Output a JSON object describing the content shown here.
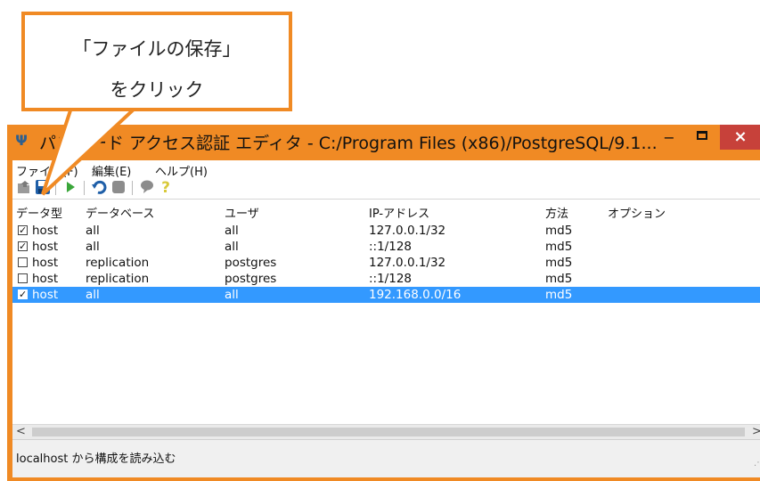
{
  "window": {
    "title": "パスワード アクセス認証 エディタ - C:/Program Files (x86)/PostgreSQL/9.1...",
    "minimize": "−",
    "close": "×"
  },
  "menu": {
    "file": "ファイル(F)",
    "edit": "編集(E)",
    "help": "ヘルプ(H)"
  },
  "toolbar": {
    "icons": [
      "open-file-icon",
      "save-file-icon",
      "run-icon",
      "undo-icon",
      "stop-icon",
      "comment-icon",
      "help-icon"
    ]
  },
  "table": {
    "headers": [
      "データ型",
      "データベース",
      "ユーザ",
      "IP-アドレス",
      "方法",
      "オプション"
    ],
    "rows": [
      {
        "checked": true,
        "type": "host",
        "db": "all",
        "user": "all",
        "ip": "127.0.0.1/32",
        "method": "md5",
        "option": "",
        "selected": false
      },
      {
        "checked": true,
        "type": "host",
        "db": "all",
        "user": "all",
        "ip": "::1/128",
        "method": "md5",
        "option": "",
        "selected": false
      },
      {
        "checked": false,
        "type": "host",
        "db": "replication",
        "user": "postgres",
        "ip": "127.0.0.1/32",
        "method": "md5",
        "option": "",
        "selected": false
      },
      {
        "checked": false,
        "type": "host",
        "db": "replication",
        "user": "postgres",
        "ip": "::1/128",
        "method": "md5",
        "option": "",
        "selected": false
      },
      {
        "checked": true,
        "type": "host",
        "db": "all",
        "user": "all",
        "ip": "192.168.0.0/16",
        "method": "md5",
        "option": "",
        "selected": true
      }
    ]
  },
  "scrollbar": {
    "left": "<",
    "right": ">"
  },
  "status": {
    "text": "localhost から構成を読み込む"
  },
  "callout": {
    "line1": "「ファイルの保存」",
    "line2": "をクリック"
  },
  "colors": {
    "accent": "#f08a24",
    "selection": "#3399ff",
    "close_button": "#c7413a"
  }
}
